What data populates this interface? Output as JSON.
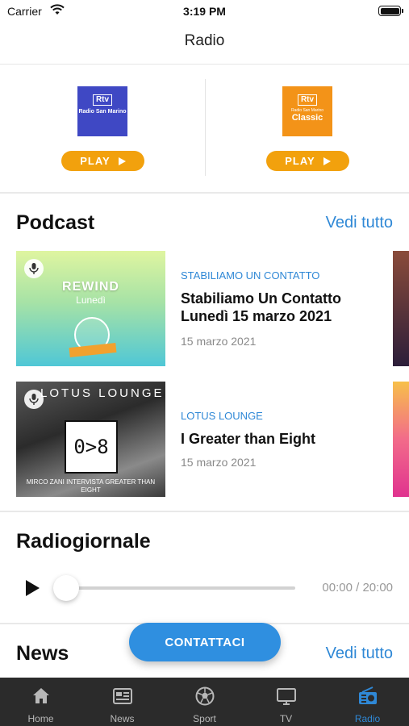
{
  "status_bar": {
    "carrier": "Carrier",
    "time": "3:19 PM"
  },
  "nav": {
    "title": "Radio"
  },
  "stations": [
    {
      "logo_text": "Rtv",
      "logo_name": "Radio San Marino",
      "play_label": "PLAY",
      "color": "#3f48c4"
    },
    {
      "logo_text": "Rtv",
      "logo_small": "Radio San Marino",
      "logo_name": "Classic",
      "play_label": "PLAY",
      "color": "#f39318"
    }
  ],
  "podcast": {
    "title": "Podcast",
    "see_all": "Vedi tutto",
    "items": [
      {
        "category": "STABILIAMO UN CONTATTO",
        "title": "Stabiliamo Un Contatto Lunedì 15 marzo 2021",
        "date": "15 marzo 2021",
        "art_title": "REWIND",
        "art_subtitle": "Lunedì"
      },
      {
        "category": "LOTUS LOUNGE",
        "title": "I Greater than Eight",
        "date": "15 marzo 2021",
        "art_title": "LOTUS LOUNGE",
        "art_box": "0>8",
        "art_caption": "MIRCO ZANI INTERVISTA GREATER THAN EIGHT"
      }
    ]
  },
  "radiogiornale": {
    "title": "Radiogiornale",
    "time_display": "00:00 / 20:00",
    "progress": 0
  },
  "news": {
    "title": "News",
    "see_all": "Vedi tutto"
  },
  "fab": {
    "label": "CONTATTACI"
  },
  "tabbar": {
    "tabs": [
      {
        "label": "Home",
        "icon": "home-icon"
      },
      {
        "label": "News",
        "icon": "newspaper-icon"
      },
      {
        "label": "Sport",
        "icon": "soccer-ball-icon"
      },
      {
        "label": "TV",
        "icon": "tv-icon"
      },
      {
        "label": "Radio",
        "icon": "radio-icon",
        "active": true
      }
    ],
    "active_color": "#2f88d6"
  },
  "colors": {
    "accent": "#2f88d6",
    "play_button": "#f2a10d",
    "tabbar_bg": "#2b2b2b"
  }
}
